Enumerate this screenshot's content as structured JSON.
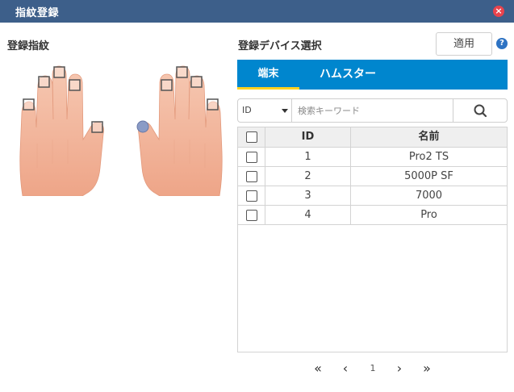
{
  "window": {
    "title": "指紋登録",
    "close_icon": "close-icon"
  },
  "left": {
    "heading": "登録指紋"
  },
  "right": {
    "heading": "登録デバイス選択",
    "apply_label": "適用",
    "help_glyph": "?",
    "tabs": [
      {
        "label": "端末"
      },
      {
        "label": "ハムスター"
      }
    ],
    "search": {
      "field_value": "ID",
      "placeholder": "検索キーワード"
    },
    "table": {
      "headers": [
        "",
        "ID",
        "名前"
      ],
      "rows": [
        {
          "id": "1",
          "name": "Pro2 TS"
        },
        {
          "id": "2",
          "name": "5000P SF"
        },
        {
          "id": "3",
          "name": "7000"
        },
        {
          "id": "4",
          "name": "Pro"
        }
      ]
    },
    "pager": {
      "first": "«",
      "prev": "‹",
      "page": "1",
      "next": "›",
      "last": "»"
    }
  },
  "colors": {
    "titlebar": "#3d5f8a",
    "tab_bar": "#0086ce",
    "tab_indicator": "#ffd21f",
    "close": "#e8434d",
    "help": "#2e73c3",
    "skin": "#f3b59b"
  }
}
